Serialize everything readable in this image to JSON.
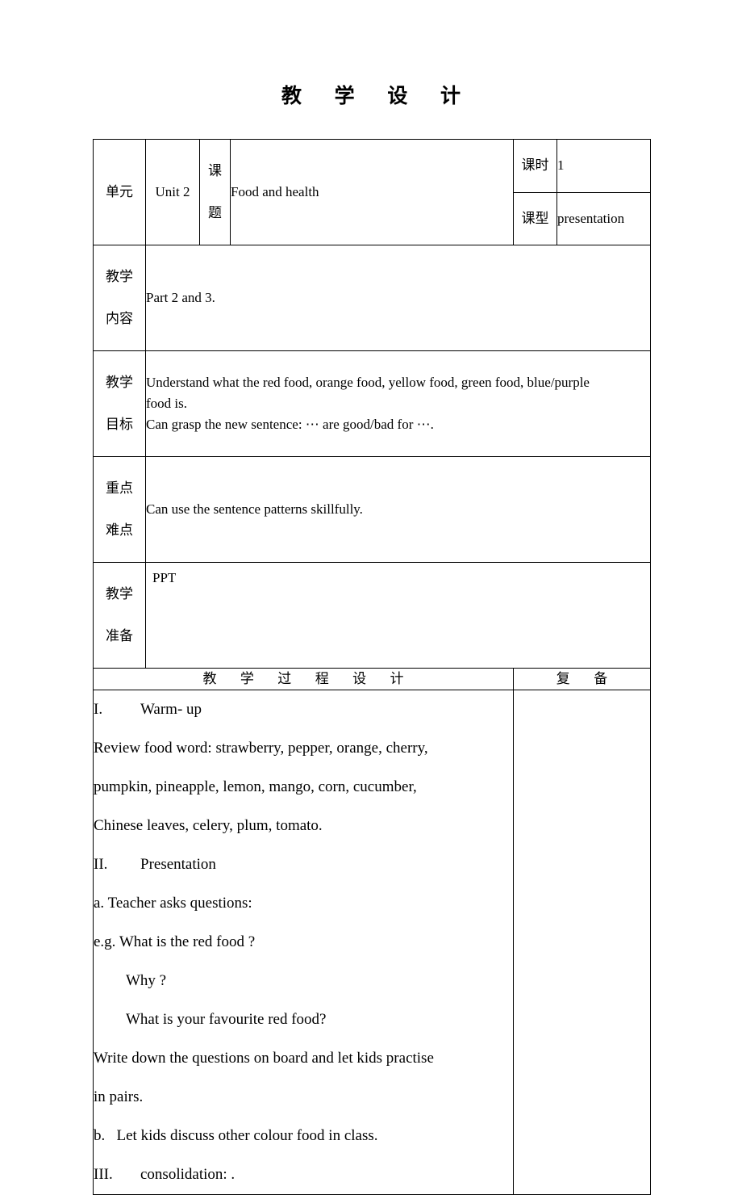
{
  "document": {
    "title": "教 学 设 计"
  },
  "info_table": {
    "row_unit": {
      "label": "单元",
      "value": "Unit 2",
      "topic_label": [
        "课",
        "题"
      ],
      "topic_value": "Food and health",
      "periods_label": "课时",
      "periods_value": "1",
      "type_label": "课型",
      "type_value": "presentation"
    },
    "row_content": {
      "label": [
        "教学",
        "内容"
      ],
      "value": "Part 2 and 3."
    },
    "row_objectives": {
      "label": [
        "教学",
        "目标"
      ],
      "lines": [
        "Understand what the red food, orange food, yellow food, green food, blue/purple",
        "food is.",
        "Can grasp the new sentence: ⋯  are good/bad for ⋯."
      ]
    },
    "row_keypoints": {
      "label": [
        "重点",
        "难点"
      ],
      "value": "Can use the sentence patterns skillfully."
    },
    "row_preparation": {
      "label": [
        "教学",
        "准备"
      ],
      "value": "PPT"
    }
  },
  "process_section": {
    "header_left": "教 学 过 程 设 计",
    "header_right": "复  备",
    "body_lines": [
      {
        "num": "I.",
        "text": "Warm- up",
        "indent": false
      },
      {
        "num": "",
        "text": "Review food word: strawberry, pepper, orange, cherry,",
        "indent": false
      },
      {
        "num": "",
        "text": "pumpkin, pineapple, lemon, mango, corn, cucumber,",
        "indent": false
      },
      {
        "num": "",
        "text": "Chinese leaves, celery, plum, tomato.",
        "indent": false
      },
      {
        "num": "II.",
        "text": "Presentation",
        "indent": false
      },
      {
        "num": "",
        "text": "a. Teacher asks questions:",
        "indent": false
      },
      {
        "num": "",
        "text": "e.g. What is the red food ?",
        "indent": false
      },
      {
        "num": "",
        "text": "Why ?",
        "indent": true
      },
      {
        "num": "",
        "text": "What is your favourite red food?",
        "indent": true
      },
      {
        "num": "",
        "text": "Write down the questions on board and let kids practise",
        "indent": false
      },
      {
        "num": "",
        "text": "in pairs.",
        "indent": false
      },
      {
        "num": "",
        "text": "b.   Let kids discuss other colour food in class.",
        "indent": false
      },
      {
        "num": "III.",
        "text": "consolidation: .",
        "indent": false
      }
    ],
    "spare_notes": ""
  }
}
